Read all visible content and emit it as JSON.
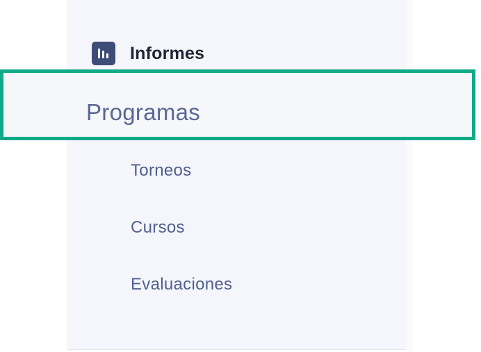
{
  "sidebar": {
    "section": {
      "icon": "bar-chart-icon",
      "label": "Informes"
    },
    "selected_item": {
      "label": "Programas"
    },
    "sub_items": [
      {
        "label": "Torneos"
      },
      {
        "label": "Cursos"
      },
      {
        "label": "Evaluaciones"
      }
    ]
  },
  "colors": {
    "highlight_border": "#11aa88",
    "icon_background": "#3e4c78",
    "sidebar_background": "#f5f6fb",
    "item_text": "#52608f",
    "header_text": "#1f2535"
  }
}
